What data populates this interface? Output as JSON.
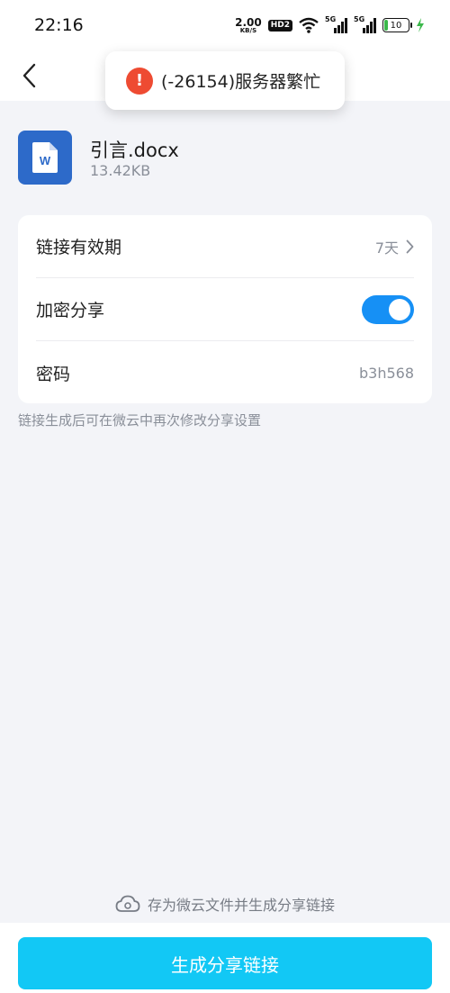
{
  "status_bar": {
    "time": "22:16",
    "net_speed_value": "2.00",
    "net_speed_unit": "KB/S",
    "hd_label": "HD2",
    "signal1_label": "5G",
    "signal2_label": "5G",
    "battery_level": "10"
  },
  "toast": {
    "message": "(-26154)服务器繁忙",
    "icon": "!"
  },
  "file": {
    "name": "引言.docx",
    "size": "13.42KB",
    "icon_letter": "W"
  },
  "settings": {
    "validity_label": "链接有效期",
    "validity_value": "7天",
    "encrypt_label": "加密分享",
    "encrypt_enabled": true,
    "password_label": "密码",
    "password_value": "b3h568"
  },
  "hint": "链接生成后可在微云中再次修改分享设置",
  "footer": {
    "save_note": "存为微云文件并生成分享链接",
    "generate_button": "生成分享链接"
  },
  "colors": {
    "accent": "#12c8f5",
    "toggle": "#1690f5",
    "error": "#ee4b32",
    "word_icon": "#2d6ac9"
  }
}
